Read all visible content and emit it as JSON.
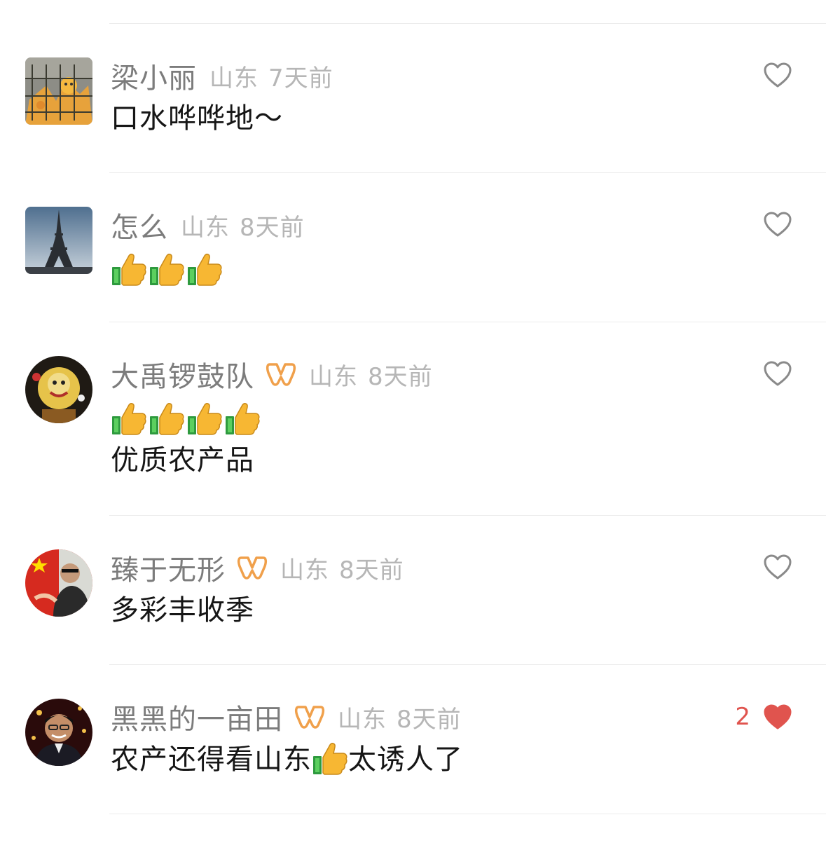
{
  "comments": [
    {
      "name": "梁小丽",
      "verified": false,
      "location": "山东",
      "time": "7天前",
      "text": "口水哗哗地～",
      "likes": "",
      "liked": false,
      "avatar": "avatar-cartoon-cat"
    },
    {
      "name": "怎么",
      "verified": false,
      "location": "山东",
      "time": "8天前",
      "text": "",
      "thumbs": 3,
      "likes": "",
      "liked": false,
      "avatar": "avatar-eiffel-tower"
    },
    {
      "name": "大禹锣鼓队",
      "verified": true,
      "location": "山东",
      "time": "8天前",
      "thumbs": 4,
      "text": "优质农产品",
      "likes": "",
      "liked": false,
      "avatar": "avatar-lion-dance"
    },
    {
      "name": "臻于无形",
      "verified": true,
      "location": "山东",
      "time": "8天前",
      "text": "多彩丰收季",
      "likes": "",
      "liked": false,
      "avatar": "avatar-man-flag"
    },
    {
      "name": "黑黑的一亩田",
      "verified": true,
      "location": "山东",
      "time": "8天前",
      "text_before": "农产还得看山东",
      "text_after": "太诱人了",
      "likes": "2",
      "liked": true,
      "avatar": "avatar-man-portrait"
    }
  ],
  "colors": {
    "name": "#7c7c7c",
    "meta": "#b6b6b6",
    "text": "#161616",
    "badge": "#f0a04b",
    "liked": "#e0544e",
    "heart_outline": "#8a8a8a"
  },
  "icons": {
    "like": "heart-outline-icon",
    "liked": "heart-filled-icon",
    "verified": "verified-badge-icon",
    "emoji": "thumbs-up-emoji-icon"
  }
}
